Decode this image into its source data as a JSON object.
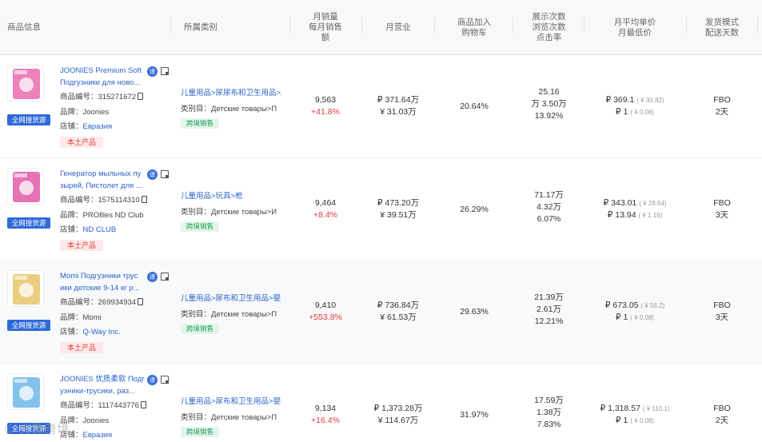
{
  "header": {
    "columns": [
      {
        "line1": "商品信息",
        "line2": "",
        "line3": ""
      },
      {
        "line1": "所属类别",
        "line2": "",
        "line3": ""
      },
      {
        "line1": "月销量",
        "line2": "每月销售",
        "line3": "额"
      },
      {
        "line1": "月营业",
        "line2": "",
        "line3": ""
      },
      {
        "line1": "商品加入",
        "line2": "购物车",
        "line3": ""
      },
      {
        "line1": "展示次数",
        "line2": "浏览次数",
        "line3": "点击率"
      },
      {
        "line1": "月平均单价",
        "line2": "月最低价",
        "line3": ""
      },
      {
        "line1": "发货模式",
        "line2": "配送天数",
        "line3": ""
      }
    ]
  },
  "labels": {
    "search_source": "全网搜货源",
    "sku_label": "商品编号：",
    "brand_label": "品牌：",
    "shop_label": "店铺：",
    "local_tag": "本土产品",
    "cat2_label": "类别目：",
    "cross_tag": "跨境销售",
    "translate_icon": "译"
  },
  "products": [
    {
      "title_line1": "JOONIES Premium Soft",
      "title_line2": "Подгузники для ново...",
      "sku": "315271672",
      "brand": "Joonies",
      "shop": "Евразия",
      "cat1": "儿童用品>尿尿布和卫生用品>尿",
      "cat2": "Детские товары>П",
      "sales": "9,563",
      "sales_growth": "+41.8%",
      "revenue": "₽ 371.64万",
      "revenue_cny": "¥ 31.03万",
      "cart_rate": "20.64%",
      "impressions": "25.16",
      "views": "万 3.50万",
      "ctr": "13.92%",
      "avg_price": "₽ 369.1",
      "avg_price_cny": "( ¥ 30.82)",
      "min_price": "₽ 1",
      "min_price_cny": "( ¥ 0.08)",
      "ship_mode": "FBO",
      "ship_days": "2天",
      "thumb_color": "#e96bb0"
    },
    {
      "title_line1": "Генератор мыльных пу",
      "title_line2": "зырей, Пистолет для ...",
      "sku": "1575114310",
      "brand": "PROfiles ND Club",
      "shop": "ND CLUB",
      "cat1": "儿童用品>玩具>枪",
      "cat2": "Детские товары>И",
      "sales": "9,464",
      "sales_growth": "+8.4%",
      "revenue": "₽ 473.20万",
      "revenue_cny": "¥ 39.51万",
      "cart_rate": "26.29%",
      "impressions": "71.17万",
      "views": "4.32万",
      "ctr": "6.07%",
      "avg_price": "₽ 343.01",
      "avg_price_cny": "( ¥ 28.64)",
      "min_price": "₽ 13.94",
      "min_price_cny": "( ¥ 1.16)",
      "ship_mode": "FBO",
      "ship_days": "3天",
      "thumb_color": "#e05aa8"
    },
    {
      "title_line1": "Momi Подгузники трус",
      "title_line2": "ики детские 9-14 кг р...",
      "sku": "269934934",
      "brand": "Momi",
      "shop": "Q-Way Inc.",
      "cat1": "儿童用品>尿布和卫生用品>婴儿",
      "cat2": "Детские товары>П",
      "sales": "9,410",
      "sales_growth": "+553.8%",
      "revenue": "₽ 736.84万",
      "revenue_cny": "¥ 61.53万",
      "cart_rate": "29.63%",
      "impressions": "21.39万",
      "views": "2.61万",
      "ctr": "12.21%",
      "avg_price": "₽ 673.05",
      "avg_price_cny": "( ¥ 56.2)",
      "min_price": "₽ 1",
      "min_price_cny": "( ¥ 0.08)",
      "ship_mode": "FBO",
      "ship_days": "3天",
      "thumb_color": "#e8c46a"
    },
    {
      "title_line1": "JOONIES 优质柔软 Подг",
      "title_line2": "узники-трусики,  раз...",
      "sku": "1117443776",
      "brand": "Joonies",
      "shop": "Евразия",
      "cat1": "儿童用品>尿布和卫生用品>婴儿",
      "cat2": "Детские товары>П",
      "sales": "9,134",
      "sales_growth": "+16.4%",
      "revenue": "₽ 1,373.28万",
      "revenue_cny": "¥ 114.67万",
      "cart_rate": "31.97%",
      "impressions": "17.59万",
      "views": "1.38万",
      "ctr": "7.83%",
      "avg_price": "₽ 1,318.57",
      "avg_price_cny": "( ¥ 110.1)",
      "min_price": "₽ 1",
      "min_price_cny": "( ¥ 0.08)",
      "ship_mode": "FBO",
      "ship_days": "2天",
      "thumb_color": "#6fb7e8"
    }
  ],
  "watermark": "© 大数跨境"
}
